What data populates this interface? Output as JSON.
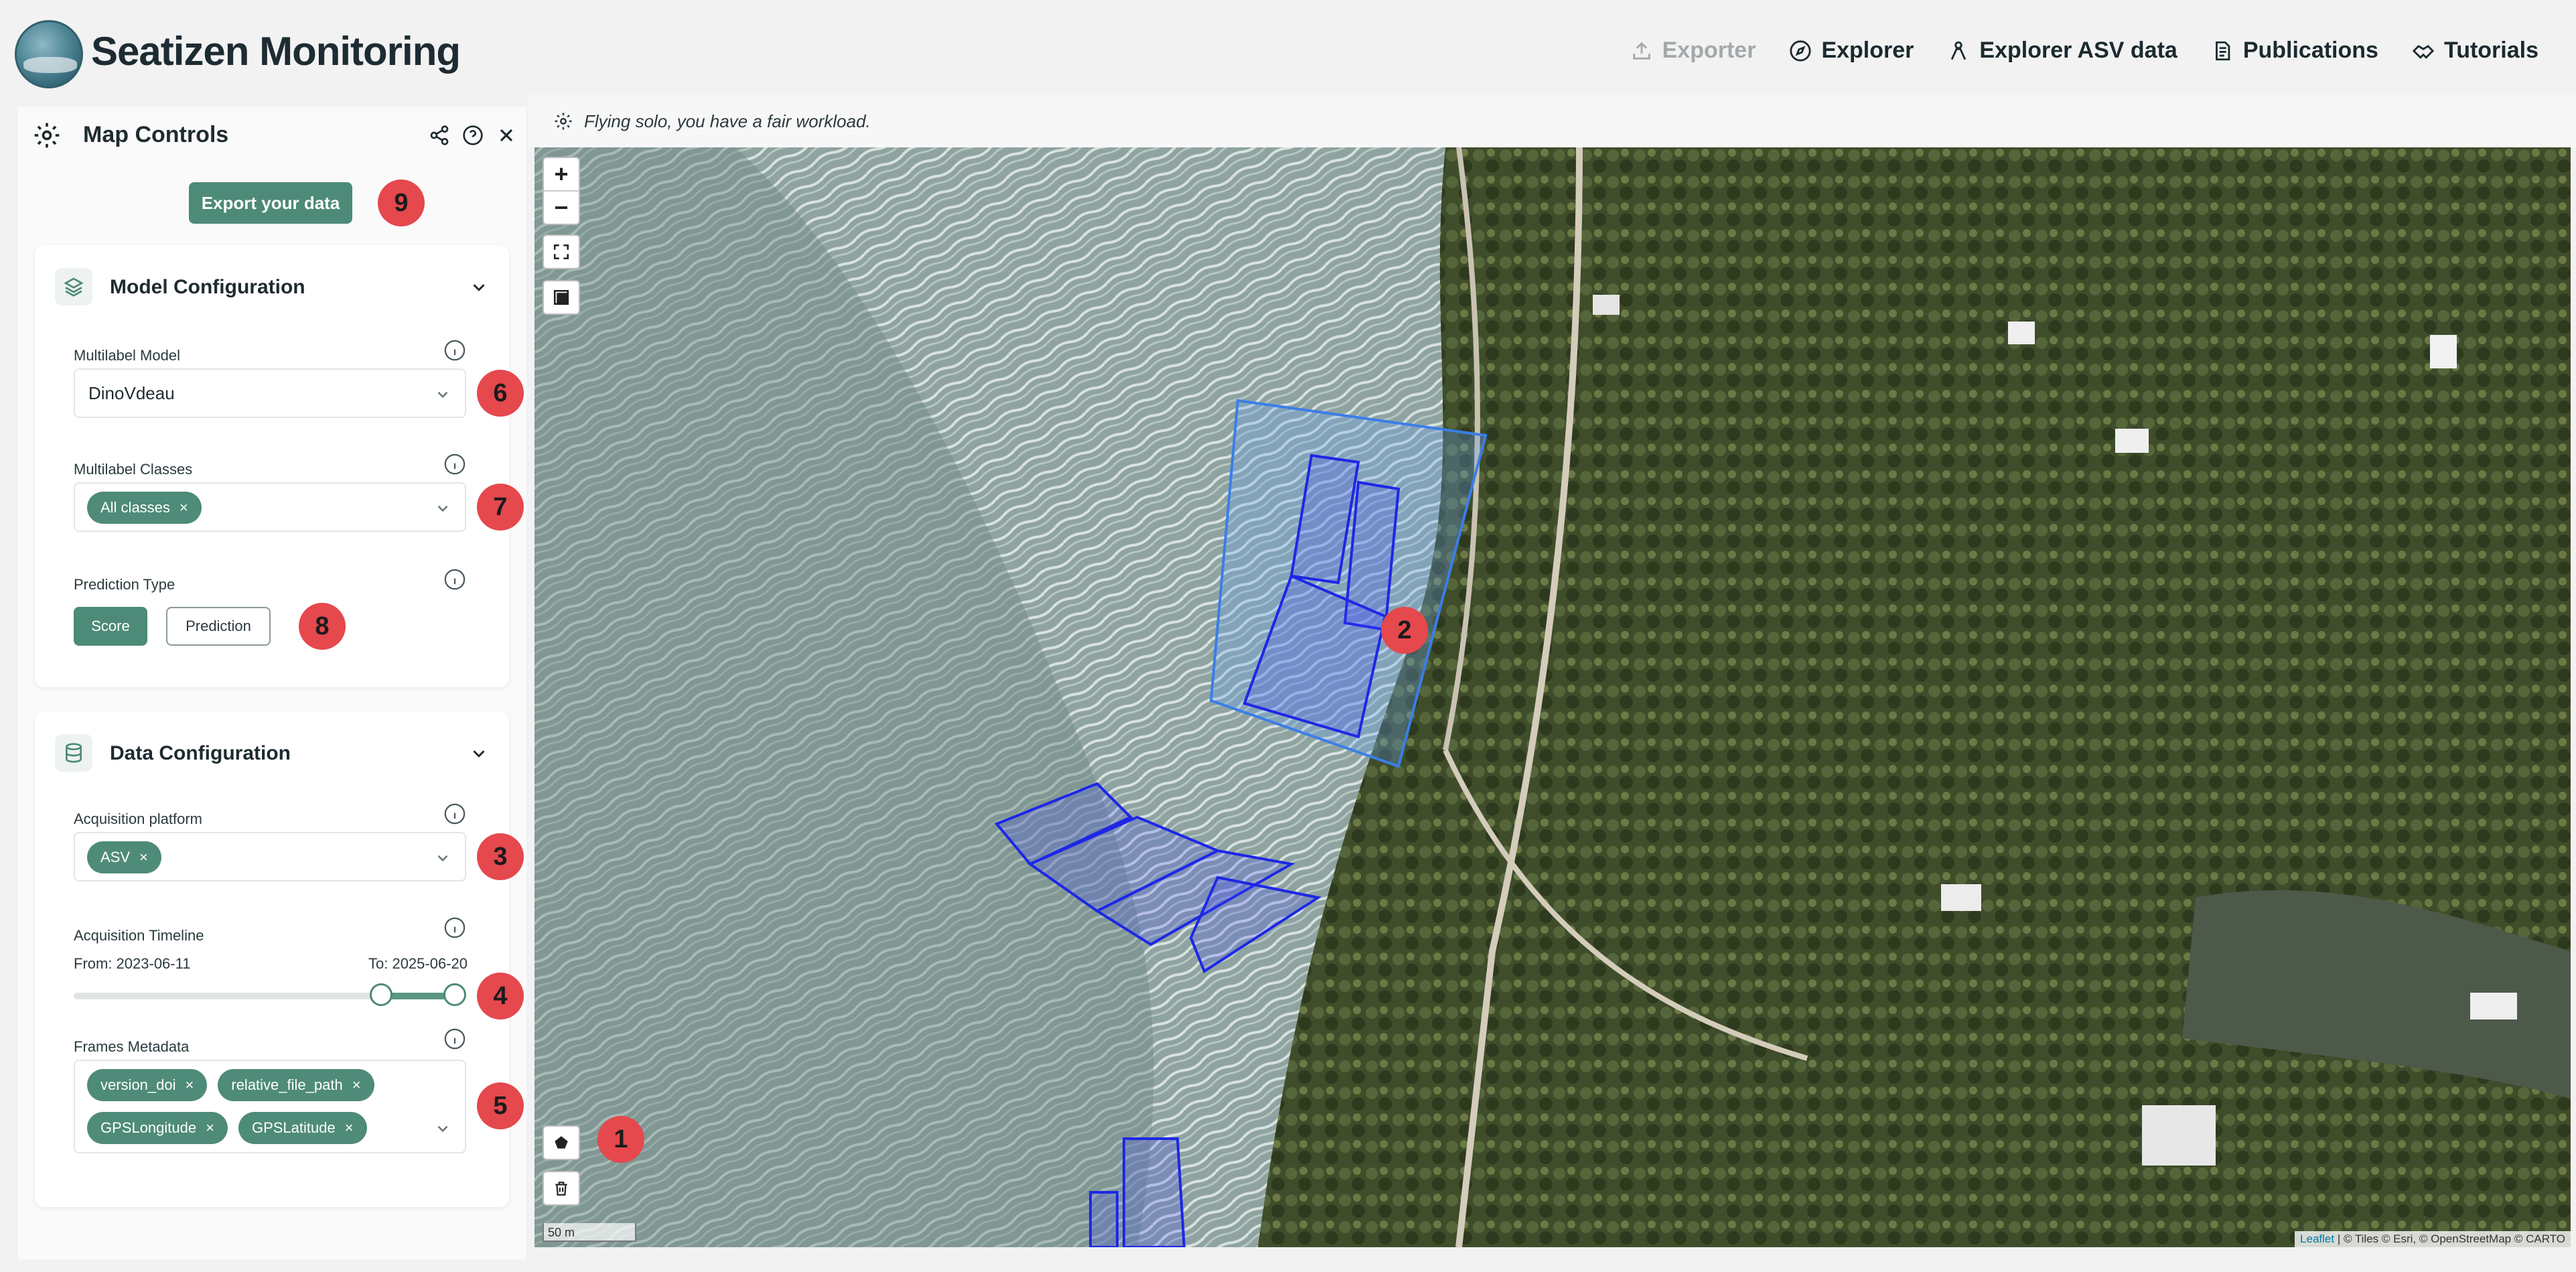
{
  "header": {
    "brand": "Seatizen Monitoring",
    "nav": [
      {
        "label": "Exporter",
        "icon": "upload-icon",
        "disabled": true
      },
      {
        "label": "Explorer",
        "icon": "compass-icon"
      },
      {
        "label": "Explorer ASV data",
        "icon": "user-pin-icon"
      },
      {
        "label": "Publications",
        "icon": "document-icon"
      },
      {
        "label": "Tutorials",
        "icon": "handshake-icon"
      }
    ]
  },
  "sidebar": {
    "title": "Map Controls",
    "export_label": "Export your data",
    "model_config": {
      "title": "Model Configuration",
      "multilabel_model_label": "Multilabel Model",
      "multilabel_model_value": "DinoVdeau",
      "multilabel_classes_label": "Multilabel Classes",
      "multilabel_classes_chips": [
        "All classes"
      ],
      "prediction_type_label": "Prediction Type",
      "score_label": "Score",
      "prediction_label": "Prediction"
    },
    "data_config": {
      "title": "Data Configuration",
      "platform_label": "Acquisition platform",
      "platform_chips": [
        "ASV"
      ],
      "timeline_label": "Acquisition Timeline",
      "from_label": "From: 2023-06-11",
      "to_label": "To: 2025-06-20",
      "timeline_range": [
        0.8,
        1.0
      ],
      "frames_metadata_label": "Frames Metadata",
      "frames_metadata_chips_row1": [
        "version_doi",
        "relative_file_path"
      ],
      "frames_metadata_chips_row2": [
        "GPSLongitude",
        "GPSLatitude"
      ]
    }
  },
  "badges": [
    "1",
    "2",
    "3",
    "4",
    "5",
    "6",
    "7",
    "8",
    "9"
  ],
  "map": {
    "status_message": "Flying solo, you have a fair workload.",
    "zoom_in": "+",
    "zoom_out": "−",
    "scale": "50 m",
    "attribution_leaflet": "Leaflet",
    "attribution_rest": "| © Tiles © Esri, © OpenStreetMap © CARTO",
    "polygon_color": "#2233dd"
  }
}
